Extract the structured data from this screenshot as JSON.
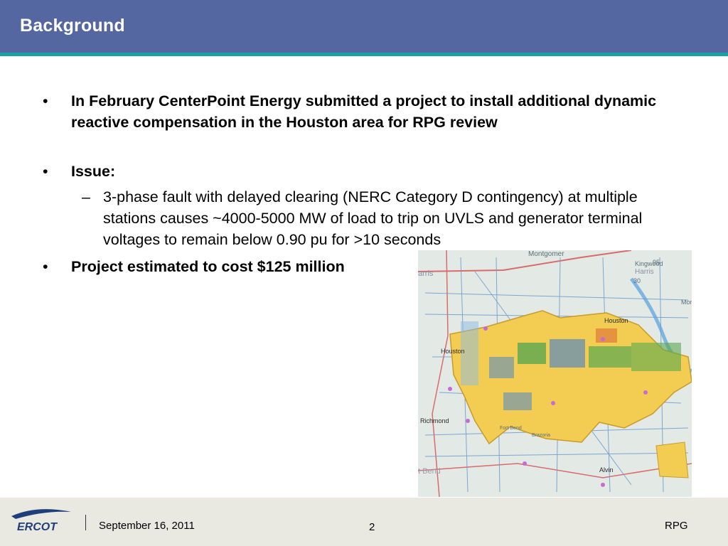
{
  "title": "Background",
  "bullets": {
    "b1": "In February CenterPoint Energy submitted a project to install additional dynamic reactive compensation in the Houston area for RPG review",
    "b2": "Issue:",
    "b2_sub": "3-phase fault with delayed clearing (NERC Category D contingency) at multiple stations causes ~4000-5000 MW of load to trip on UVLS and generator terminal voltages to remain below 0.90 pu for >10 seconds",
    "b3": "Project estimated to cost $125 million"
  },
  "map_labels": {
    "montgomery": "Montgomer",
    "kingwood": "Kingwood",
    "harris_top": "Harris",
    "num_95": "95",
    "num_30": "30",
    "arris": "arris",
    "mon": "Mon",
    "houston_north": "Houston",
    "houston_west": "Houston",
    "richmond": "Richmond",
    "fort_bend_small": "Fort Bend",
    "fort_bend": "t Bend",
    "brazoria": "Brazoria",
    "alvin": "Alvin"
  },
  "footer": {
    "logo_text": "ERCOT",
    "date": "September 16, 2011",
    "page": "2",
    "section": "RPG"
  },
  "colors": {
    "header": "#5467a0",
    "header_rule": "#17a2a6",
    "footer": "#e9e8e1",
    "map_load_area": "#f2cd52",
    "logo": "#1f3f7a"
  }
}
